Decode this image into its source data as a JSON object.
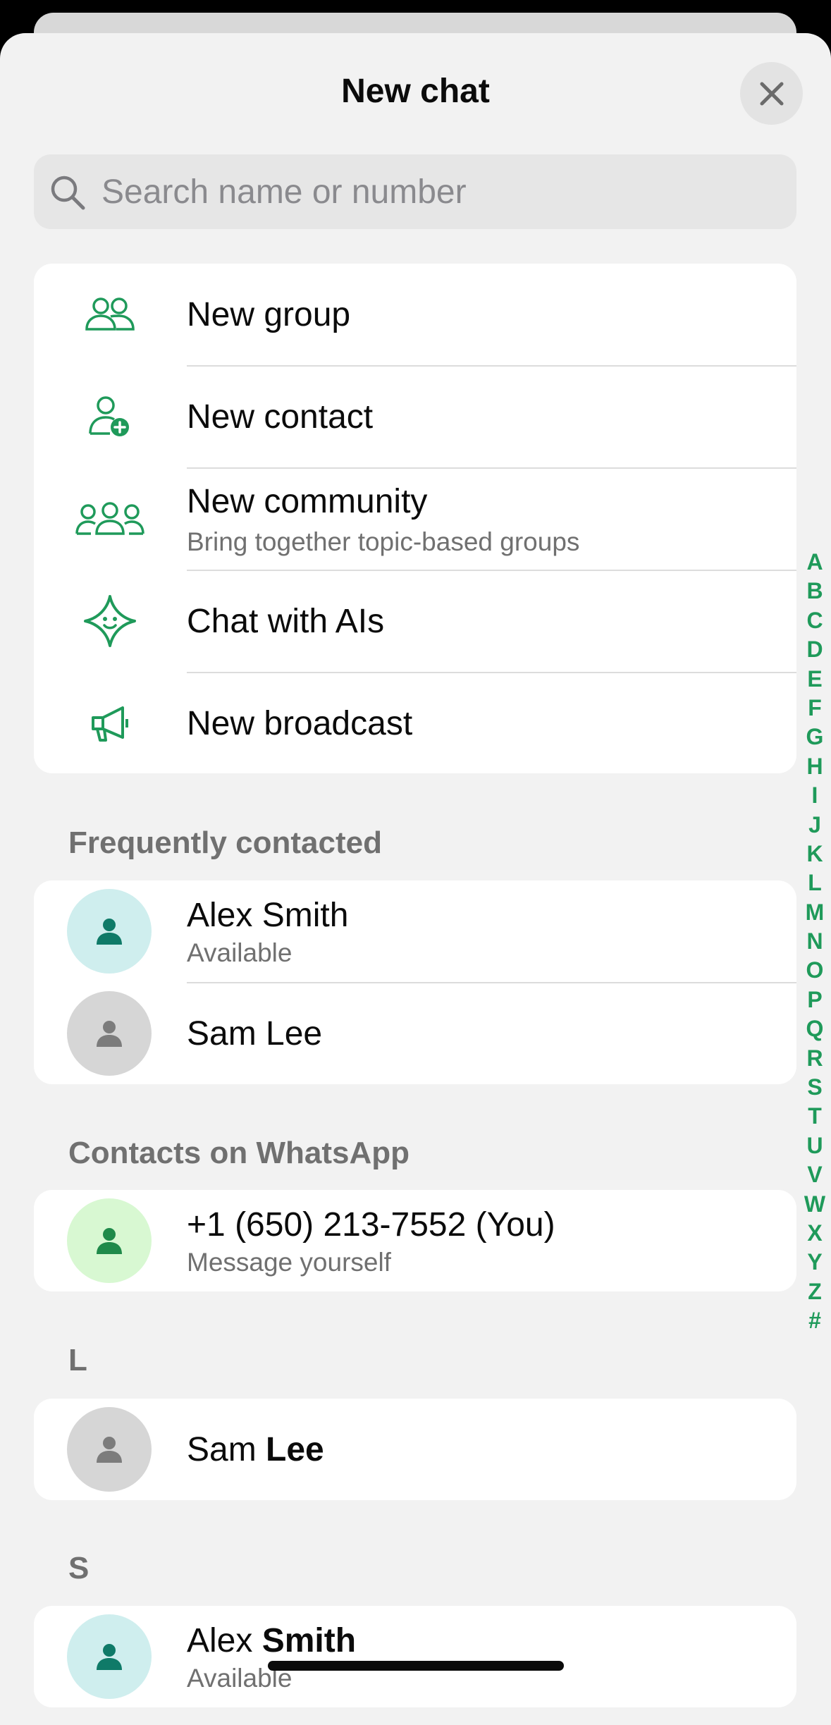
{
  "header": {
    "title": "New chat"
  },
  "search": {
    "placeholder": "Search name or number"
  },
  "actions": [
    {
      "label": "New group",
      "icon": "group-icon"
    },
    {
      "label": "New contact",
      "icon": "add-contact-icon"
    },
    {
      "label": "New community",
      "sub": "Bring together topic-based groups",
      "icon": "community-icon"
    },
    {
      "label": "Chat with AIs",
      "icon": "ai-sparkle-icon"
    },
    {
      "label": "New broadcast",
      "icon": "megaphone-icon"
    }
  ],
  "frequent": {
    "heading": "Frequently contacted",
    "contacts": [
      {
        "name": "Alex Smith",
        "status": "Available"
      },
      {
        "name": "Sam Lee"
      }
    ]
  },
  "whatsapp": {
    "heading": "Contacts on WhatsApp",
    "contacts": [
      {
        "name": "+1 (650) 213-7552 (You)",
        "status": "Message yourself"
      }
    ]
  },
  "section_l": {
    "heading": "L",
    "contact": {
      "first": "Sam ",
      "last": "Lee"
    }
  },
  "section_s": {
    "heading": "S",
    "contact": {
      "first": "Alex ",
      "last": "Smith",
      "status": "Available"
    }
  },
  "index": [
    "A",
    "B",
    "C",
    "D",
    "E",
    "F",
    "G",
    "H",
    "I",
    "J",
    "K",
    "L",
    "M",
    "N",
    "O",
    "P",
    "Q",
    "R",
    "S",
    "T",
    "U",
    "V",
    "W",
    "X",
    "Y",
    "Z",
    "#"
  ],
  "colors": {
    "accent": "#1f9a5a",
    "avatar_teal_bg": "#cfeeee",
    "avatar_teal_fg": "#0f7a68",
    "avatar_gray_bg": "#d6d6d6",
    "avatar_gray_fg": "#7c7c7c",
    "avatar_green_bg": "#d8f8d2",
    "avatar_green_fg": "#1f8a4a"
  }
}
